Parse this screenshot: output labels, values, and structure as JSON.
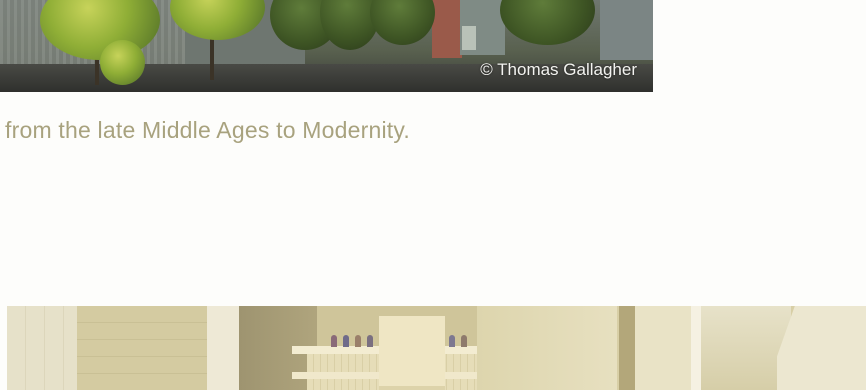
{
  "photo_top": {
    "credit": "© Thomas Gallagher"
  },
  "caption": {
    "text": "from the late Middle Ages to Modernity."
  }
}
